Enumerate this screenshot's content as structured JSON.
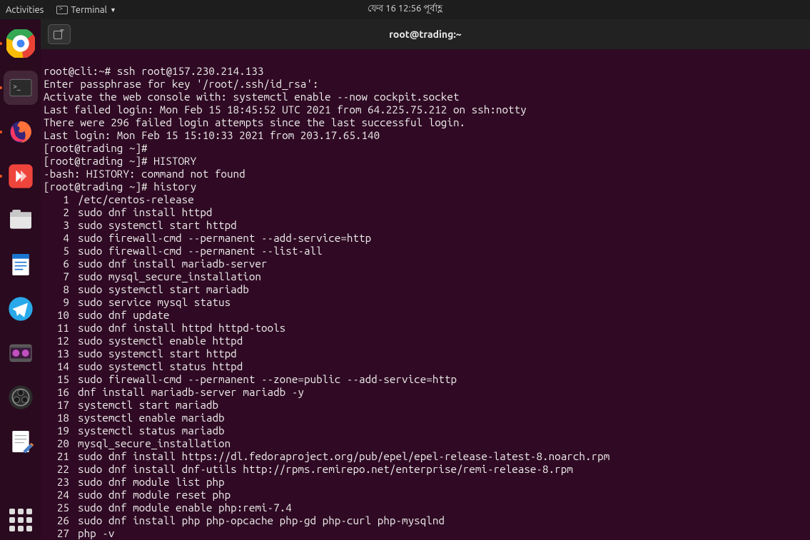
{
  "topbar": {
    "activities": "Activities",
    "terminal_label": "Terminal",
    "clock": "ফেব 16  12:56 পূর্বাহ্ণ"
  },
  "titlebar": {
    "new_tab_glyph": "⊞",
    "title": "root@trading:~"
  },
  "session": {
    "lines": [
      "root@cli:~# ssh root@157.230.214.133",
      "Enter passphrase for key '/root/.ssh/id_rsa':",
      "Activate the web console with: systemctl enable --now cockpit.socket",
      "",
      "Last failed login: Mon Feb 15 18:45:52 UTC 2021 from 64.225.75.212 on ssh:notty",
      "There were 296 failed login attempts since the last successful login.",
      "Last login: Mon Feb 15 15:10:33 2021 from 203.17.65.140",
      "[root@trading ~]#",
      "[root@trading ~]# HISTORY",
      "-bash: HISTORY: command not found",
      "[root@trading ~]# history"
    ]
  },
  "history": [
    {
      "n": "1",
      "c": "/etc/centos-release"
    },
    {
      "n": "2",
      "c": "sudo dnf install httpd"
    },
    {
      "n": "3",
      "c": "sudo systemctl start httpd"
    },
    {
      "n": "4",
      "c": "sudo firewall-cmd --permanent --add-service=http"
    },
    {
      "n": "5",
      "c": "sudo firewall-cmd --permanent --list-all"
    },
    {
      "n": "6",
      "c": "sudo dnf install mariadb-server"
    },
    {
      "n": "7",
      "c": "sudo mysql_secure_installation"
    },
    {
      "n": "8",
      "c": "sudo systemctl start mariadb"
    },
    {
      "n": "9",
      "c": "sudo service mysql status"
    },
    {
      "n": "10",
      "c": "sudo dnf update"
    },
    {
      "n": "11",
      "c": "sudo dnf install httpd httpd-tools"
    },
    {
      "n": "12",
      "c": "sudo systemctl enable httpd"
    },
    {
      "n": "13",
      "c": "sudo systemctl start httpd"
    },
    {
      "n": "14",
      "c": "sudo systemctl status httpd"
    },
    {
      "n": "15",
      "c": "sudo firewall-cmd --permanent --zone=public --add-service=http"
    },
    {
      "n": "16",
      "c": "dnf install mariadb-server mariadb -y"
    },
    {
      "n": "17",
      "c": "systemctl start mariadb"
    },
    {
      "n": "18",
      "c": "systemctl enable mariadb"
    },
    {
      "n": "19",
      "c": "systemctl status mariadb"
    },
    {
      "n": "20",
      "c": "mysql_secure_installation"
    },
    {
      "n": "21",
      "c": "sudo dnf install https://dl.fedoraproject.org/pub/epel/epel-release-latest-8.noarch.rpm"
    },
    {
      "n": "22",
      "c": "sudo dnf install dnf-utils http://rpms.remirepo.net/enterprise/remi-release-8.rpm"
    },
    {
      "n": "23",
      "c": "sudo dnf module list php"
    },
    {
      "n": "24",
      "c": "sudo dnf module reset php"
    },
    {
      "n": "25",
      "c": "sudo dnf module enable php:remi-7.4"
    },
    {
      "n": "26",
      "c": "sudo dnf install php php-opcache php-gd php-curl php-mysqlnd"
    },
    {
      "n": "27",
      "c": "php -v"
    }
  ],
  "dock_icons": [
    "chrome",
    "terminal",
    "firefox",
    "anydesk",
    "files",
    "writer",
    "telegram",
    "video",
    "obs",
    "gedit"
  ]
}
